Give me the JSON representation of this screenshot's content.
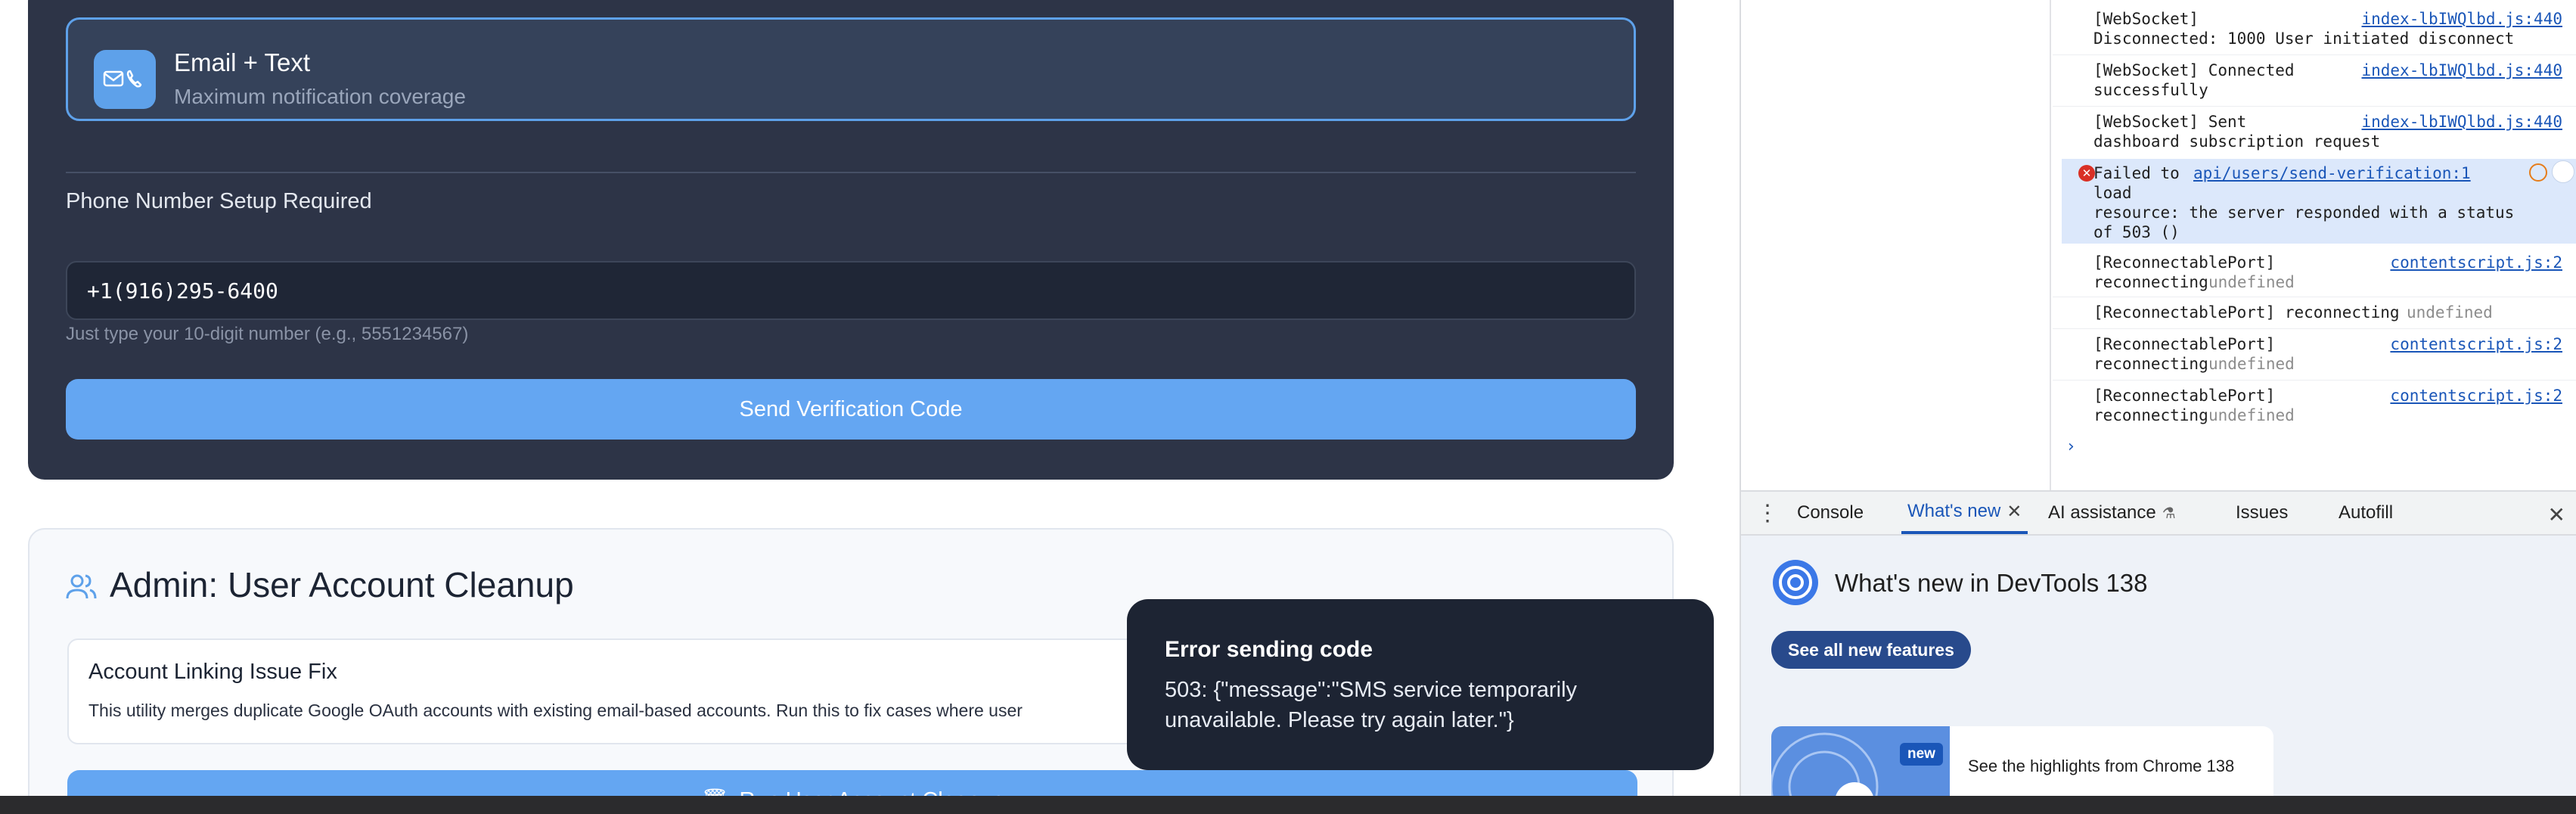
{
  "notification_option": {
    "title": "Email + Text",
    "subtitle": "Maximum notification coverage"
  },
  "phone_setup": {
    "heading": "Phone Number Setup Required",
    "input_value": "+1(916)295-6400",
    "hint": "Just type your 10-digit number (e.g., 5551234567)",
    "send_button": "Send Verification Code"
  },
  "admin": {
    "title": "Admin: User Account Cleanup",
    "fix_title": "Account Linking Issue Fix",
    "fix_desc": "This utility merges duplicate Google OAuth accounts with existing email-based accounts. Run this to fix cases where user",
    "run_button": "Run User Account Cleanup"
  },
  "toast": {
    "title": "Error sending code",
    "message": "503: {\"message\":\"SMS service temporarily unavailable. Please try again later.\"}"
  },
  "console": {
    "messages": [
      {
        "text": "[WebSocket]\nDisconnected: 1000 User initiated disconnect",
        "source": "index-lbIWQlbd.js:440"
      },
      {
        "text": "[WebSocket] Connected\nsuccessfully",
        "source": "index-lbIWQlbd.js:440"
      },
      {
        "text": "[WebSocket] Sent\ndashboard subscription request",
        "source": "index-lbIWQlbd.js:440"
      },
      {
        "text": "Failed to\nload\nresource: the server responded with a status\nof 503 ()",
        "source": "api/users/send-verification:1",
        "level": "error"
      },
      {
        "text": "[ReconnectablePort]\nreconnecting",
        "dim": "undefined",
        "source": "contentscript.js:2"
      },
      {
        "text": "[ReconnectablePort] reconnecting",
        "dim": "undefined",
        "source": ""
      },
      {
        "text": "[ReconnectablePort]\nreconnecting",
        "dim": "undefined",
        "source": "contentscript.js:2"
      },
      {
        "text": "[ReconnectablePort]\nreconnecting",
        "dim": "undefined",
        "source": "contentscript.js:2"
      }
    ],
    "prompt": "›"
  },
  "drawer_tabs": [
    "Console",
    "What's new",
    "AI assistance",
    "Issues",
    "Autofill"
  ],
  "whats_new": {
    "title": "What's new in DevTools 138",
    "button": "See all new features",
    "badge": "new",
    "card_text": "See the highlights from Chrome 138"
  },
  "colors": {
    "accent": "#64a6f2",
    "dark_card": "#2d3447",
    "toast_bg": "#1d2433",
    "error": "#d93025",
    "devtools_link": "#1a56b8"
  }
}
